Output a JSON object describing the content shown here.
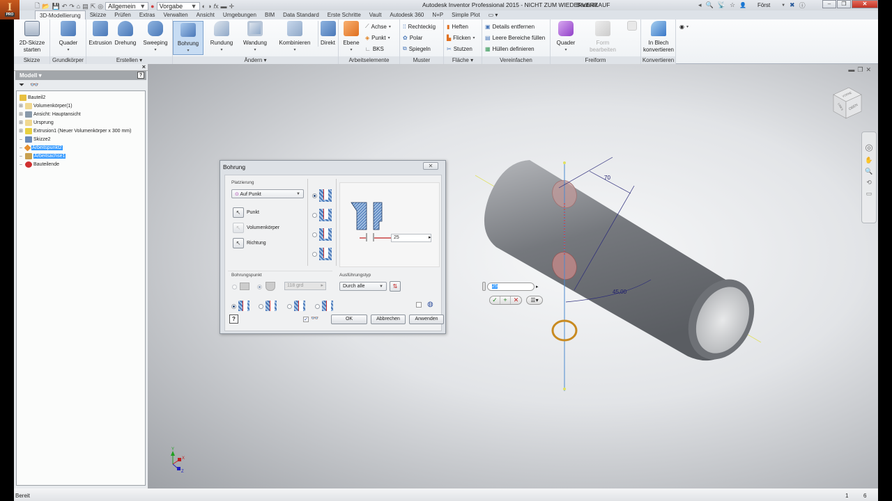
{
  "app": {
    "logo_text": "I",
    "logo_sub": "PRO",
    "title": "Autodesk Inventor Professional 2015 - NICHT ZUM WIEDERVERKAUF",
    "document": "Bauteil2",
    "user": "Först",
    "quick_access": {
      "appearance_select": "Allgemein",
      "material_select": "Vorgabe"
    }
  },
  "tabs": [
    {
      "label": "3D-Modellierung",
      "active": true
    },
    {
      "label": "Skizze"
    },
    {
      "label": "Prüfen"
    },
    {
      "label": "Extras"
    },
    {
      "label": "Verwalten"
    },
    {
      "label": "Ansicht"
    },
    {
      "label": "Umgebungen"
    },
    {
      "label": "BIM"
    },
    {
      "label": "Data Standard"
    },
    {
      "label": "Erste Schritte"
    },
    {
      "label": "Vault"
    },
    {
      "label": "Autodesk 360"
    },
    {
      "label": "N+P"
    },
    {
      "label": "Simple Plot"
    }
  ],
  "ribbon": {
    "panels": {
      "skizze": "Skizze",
      "grundkoerper": "Grundkörper",
      "erstellen": "Erstellen",
      "aendern": "Ändern",
      "arbeitselemente": "Arbeitselemente",
      "muster": "Muster",
      "flaeche": "Fläche",
      "vereinfachen": "Vereinfachen",
      "freiform": "Freiform",
      "konvertieren": "Konvertieren"
    },
    "buttons": {
      "skizze_start_1": "2D-Skizze",
      "skizze_start_2": "starten",
      "quader": "Quader",
      "extrusion": "Extrusion",
      "drehung": "Drehung",
      "sweeping": "Sweeping",
      "bohrung": "Bohrung",
      "rundung": "Rundung",
      "wandung": "Wandung",
      "kombinieren": "Kombinieren",
      "direkt": "Direkt",
      "ebene": "Ebene",
      "achse": "Achse",
      "punkt": "Punkt",
      "bks": "BKS",
      "rechteckig": "Rechteckig",
      "polar": "Polar",
      "spiegeln": "Spiegeln",
      "heften": "Heften",
      "flicken": "Flicken",
      "stutzen": "Stutzen",
      "details_entfernen": "Details entfernen",
      "leere_bereiche": "Leere Bereiche füllen",
      "huellen": "Hüllen definieren",
      "ff_quader": "Quader",
      "form_1": "Form",
      "form_2": "bearbeiten",
      "blech_1": "In Blech",
      "blech_2": "konvertieren"
    }
  },
  "browser": {
    "header": "Modell",
    "items": [
      {
        "label": "Bauteil2",
        "level": 0,
        "icon": "part-icon",
        "color": "#e8c040"
      },
      {
        "label": "Volumenkörper(1)",
        "level": 1,
        "expandable": true,
        "icon": "solid-bodies-folder-icon",
        "color": "#f0d890"
      },
      {
        "label": "Ansicht: Hauptansicht",
        "level": 1,
        "expandable": true,
        "icon": "view-icon",
        "color": "#8899aa"
      },
      {
        "label": "Ursprung",
        "level": 1,
        "expandable": true,
        "icon": "folder-icon",
        "color": "#f0d890"
      },
      {
        "label": "Extrusion1 (Neuer Volumenkörper x 300 mm)",
        "level": 1,
        "expandable": true,
        "icon": "extrusion-icon",
        "color": "#e8d040"
      },
      {
        "label": "Skizze2",
        "level": 1,
        "icon": "sketch-icon",
        "color": "#6a8ab8"
      },
      {
        "label": "Arbeitspunkt2",
        "level": 1,
        "icon": "workpoint-icon",
        "color": "#e89030",
        "selected": true
      },
      {
        "label": "Arbeitsachse1",
        "level": 1,
        "icon": "workaxis-icon",
        "color": "#c8a050",
        "selected": true
      },
      {
        "label": "Bauteilende",
        "level": 1,
        "icon": "end-of-part-icon",
        "color": "#d03030"
      }
    ]
  },
  "dialog": {
    "title": "Bohrung",
    "platzierung_label": "Platzierung",
    "platzierung_value": "Auf Punkt",
    "select_punkt": "Punkt",
    "select_volumenkoerper": "Volumenkörper",
    "select_richtung": "Richtung",
    "diameter_value": "25",
    "bohrungspunkt_label": "Bohrungspunkt",
    "angle_value": "118 grd",
    "ausfuehrung_label": "Ausführungstyp",
    "ausfuehrung_value": "Durch alle",
    "ok": "OK",
    "abbrechen": "Abbrechen",
    "anwenden": "Anwenden",
    "preview_checked": true
  },
  "viewport": {
    "viewcube_labels": [
      "OBEN",
      "VORNE",
      "LINKS"
    ],
    "dimension_length": "70",
    "dimension_angle": "45,00",
    "mini_input_value": "25",
    "triad": {
      "x": "X",
      "y": "Y",
      "z": "Z"
    }
  },
  "status": {
    "text": "Bereit",
    "count1": "1",
    "count2": "6"
  }
}
